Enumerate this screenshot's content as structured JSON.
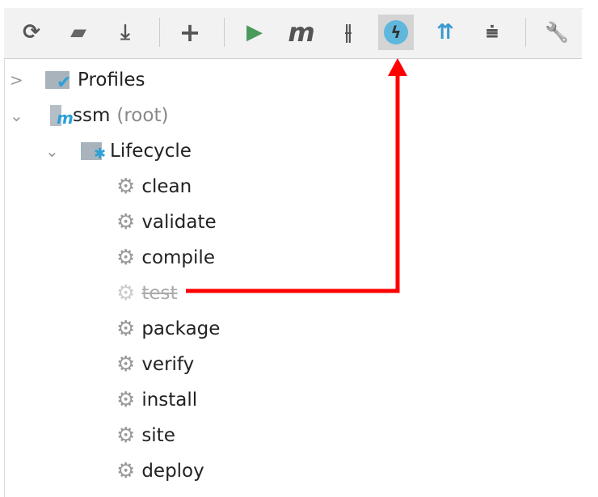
{
  "toolbar": {
    "items": [
      {
        "name": "reimport-icon",
        "glyph": "⟳"
      },
      {
        "name": "generate-sources-icon",
        "glyph": "▰"
      },
      {
        "name": "download-icon",
        "glyph": "⤓"
      },
      {
        "name": "add-icon",
        "glyph": "+"
      },
      {
        "name": "run-icon",
        "glyph": "▶"
      },
      {
        "name": "execute-goal-icon",
        "glyph": "m"
      },
      {
        "name": "toggle-offline-icon",
        "glyph": "⫲"
      },
      {
        "name": "skip-tests-icon",
        "glyph": "ϟ"
      },
      {
        "name": "show-dependencies-icon",
        "glyph": "⇈"
      },
      {
        "name": "collapse-all-icon",
        "glyph": "⩧"
      },
      {
        "name": "settings-wrench-icon",
        "glyph": "🔧"
      }
    ],
    "active_item": "skip-tests-icon"
  },
  "tree": {
    "profiles": "Profiles",
    "project": {
      "name": "ssm",
      "suffix": "(root)"
    },
    "lifecycle": "Lifecycle",
    "phases": [
      "clean",
      "validate",
      "compile",
      "test",
      "package",
      "verify",
      "install",
      "site",
      "deploy"
    ],
    "skipped_phase": "test"
  },
  "annotation": {
    "color": "#ff0000"
  }
}
